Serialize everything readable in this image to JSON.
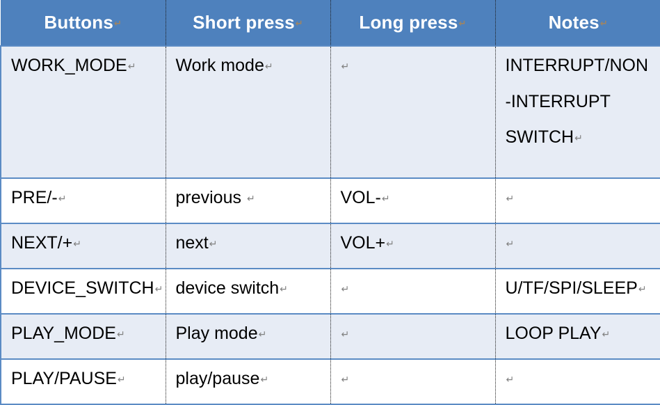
{
  "table": {
    "return_mark": "↵",
    "colors": {
      "header_bg": "#4e81bd",
      "header_text": "#ffffff",
      "row_shade": "#e7ecf5",
      "row_plain": "#ffffff",
      "row_border": "#5b8bc4",
      "column_divider": "#1a1a1a",
      "return_mark": "#808080"
    },
    "headers": [
      {
        "label": "Buttons"
      },
      {
        "label": "Short press"
      },
      {
        "label": "Long press"
      },
      {
        "label": "Notes"
      }
    ],
    "rows": [
      {
        "shade": "light",
        "height": "tall",
        "cells": {
          "button": "WORK_MODE",
          "short_press": "Work mode",
          "long_press": "",
          "notes_lines": [
            "INTERRUPT/NON",
            "-INTERRUPT",
            "SWITCH"
          ],
          "notes": "INTERRUPT/NON-INTERRUPT SWITCH"
        }
      },
      {
        "shade": "white",
        "height": "std",
        "cells": {
          "button": "PRE/-",
          "short_press": "previous ",
          "long_press": "VOL-",
          "notes": ""
        }
      },
      {
        "shade": "light",
        "height": "std",
        "cells": {
          "button": "NEXT/+",
          "short_press": "next",
          "long_press": "VOL+",
          "notes": ""
        }
      },
      {
        "shade": "white",
        "height": "std",
        "cells": {
          "button": "DEVICE_SWITCH",
          "short_press": "device switch",
          "long_press": "",
          "notes": "U/TF/SPI/SLEEP"
        }
      },
      {
        "shade": "light",
        "height": "std",
        "cells": {
          "button": "PLAY_MODE",
          "short_press": "Play mode",
          "long_press": "",
          "notes": "LOOP PLAY"
        }
      },
      {
        "shade": "white",
        "height": "std",
        "cells": {
          "button": "PLAY/PAUSE",
          "short_press": "play/pause",
          "long_press": "",
          "notes": ""
        }
      }
    ]
  }
}
